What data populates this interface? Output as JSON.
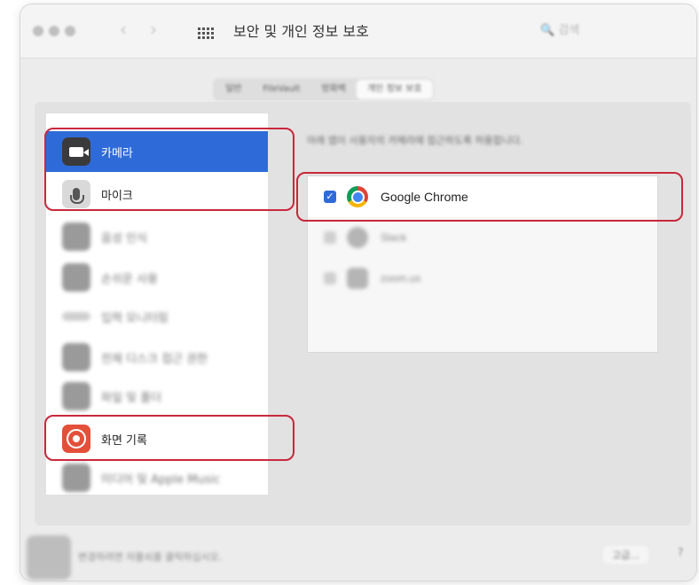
{
  "window": {
    "title": "보안 및 개인 정보 보호",
    "search_placeholder": "검색"
  },
  "tabs": [
    {
      "label": "일반"
    },
    {
      "label": "FileVault"
    },
    {
      "label": "방화벽"
    },
    {
      "label": "개인 정보 보호",
      "active": true
    }
  ],
  "sidebar": {
    "items": [
      {
        "label": "카메라",
        "icon": "camera-icon",
        "selected": true
      },
      {
        "label": "마이크",
        "icon": "microphone-icon"
      },
      {
        "label": "음성 인식",
        "icon": "speech-icon"
      },
      {
        "label": "손쉬운 사용",
        "icon": "accessibility-icon"
      },
      {
        "label": "입력 모니터링",
        "icon": "keyboard-icon"
      },
      {
        "label": "전체 디스크 접근 권한",
        "icon": "folder-icon"
      },
      {
        "label": "파일 및 폴더",
        "icon": "folder-icon"
      },
      {
        "label": "화면 기록",
        "icon": "screen-record-icon"
      },
      {
        "label": "미디어 및 Apple Music",
        "icon": "music-icon"
      }
    ]
  },
  "main": {
    "description": "아래 앱이 사용자의 카메라에 접근하도록 허용합니다.",
    "apps": [
      {
        "name": "Google Chrome",
        "checked": true,
        "icon": "chrome-icon"
      },
      {
        "name": "Slack",
        "checked": false,
        "icon": "slack-icon"
      },
      {
        "name": "zoom.us",
        "checked": false,
        "icon": "zoom-icon"
      }
    ]
  },
  "footer": {
    "lock_text": "변경하려면 자물쇠를 클릭하십시오.",
    "advanced_button": "고급...",
    "help_label": "?"
  },
  "colors": {
    "selection_blue": "#2f6bd8",
    "highlight_red": "#c8283c",
    "screen_record_orange": "#e3503a"
  }
}
